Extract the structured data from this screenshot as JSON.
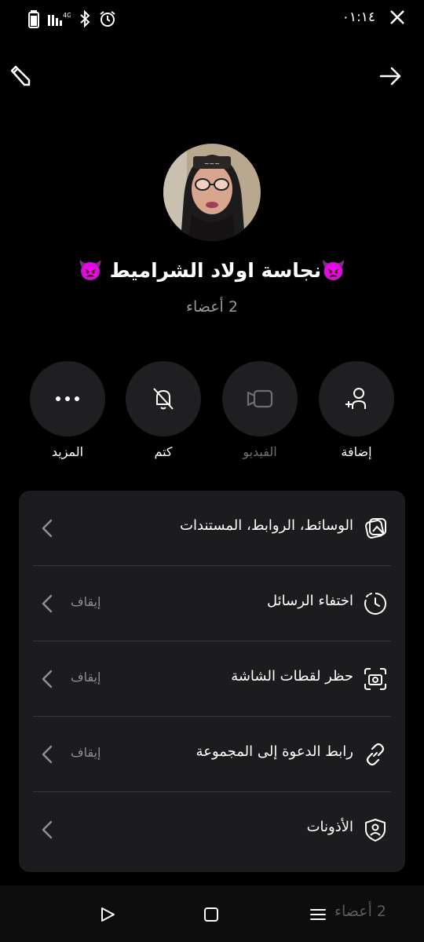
{
  "status_bar": {
    "time": "٠١:١٤",
    "network": "4G",
    "icons": [
      "battery-icon",
      "signal-icon",
      "bluetooth-icon",
      "alarm-icon",
      "x-app-icon"
    ]
  },
  "header": {
    "edit_icon": "pencil-icon",
    "back_icon": "arrow-right-icon"
  },
  "group": {
    "name": "نجاسة اولاد الشراميط",
    "emoji_left": "👿",
    "emoji_right": "👿",
    "members": "2 أعضاء"
  },
  "actions": [
    {
      "label": "إضافة",
      "icon": "add-person-icon",
      "enabled": true
    },
    {
      "label": "الفيديو",
      "icon": "video-icon",
      "enabled": false
    },
    {
      "label": "كتم",
      "icon": "bell-off-icon",
      "enabled": true
    },
    {
      "label": "المزيد",
      "icon": "more-icon",
      "enabled": true
    }
  ],
  "settings": [
    {
      "title": "الوسائط، الروابط، المستندات",
      "value": "",
      "icon": "media-icon"
    },
    {
      "title": "اختفاء الرسائل",
      "value": "إيقاف",
      "icon": "timer-icon"
    },
    {
      "title": "حظر لقطات الشاشة",
      "value": "إيقاف",
      "icon": "screenshot-icon"
    },
    {
      "title": "رابط الدعوة إلى المجموعة",
      "value": "إيقاف",
      "icon": "link-icon"
    },
    {
      "title": "الأذونات",
      "value": "",
      "icon": "shield-person-icon"
    }
  ],
  "navbar": {
    "text": "2 أعضاء",
    "icons": [
      "menu-icon",
      "home-square-icon",
      "back-triangle-icon"
    ]
  },
  "colors": {
    "background": "#000000",
    "card": "#1c1c1e",
    "button": "#1f1f21",
    "muted": "#8e8e93"
  }
}
